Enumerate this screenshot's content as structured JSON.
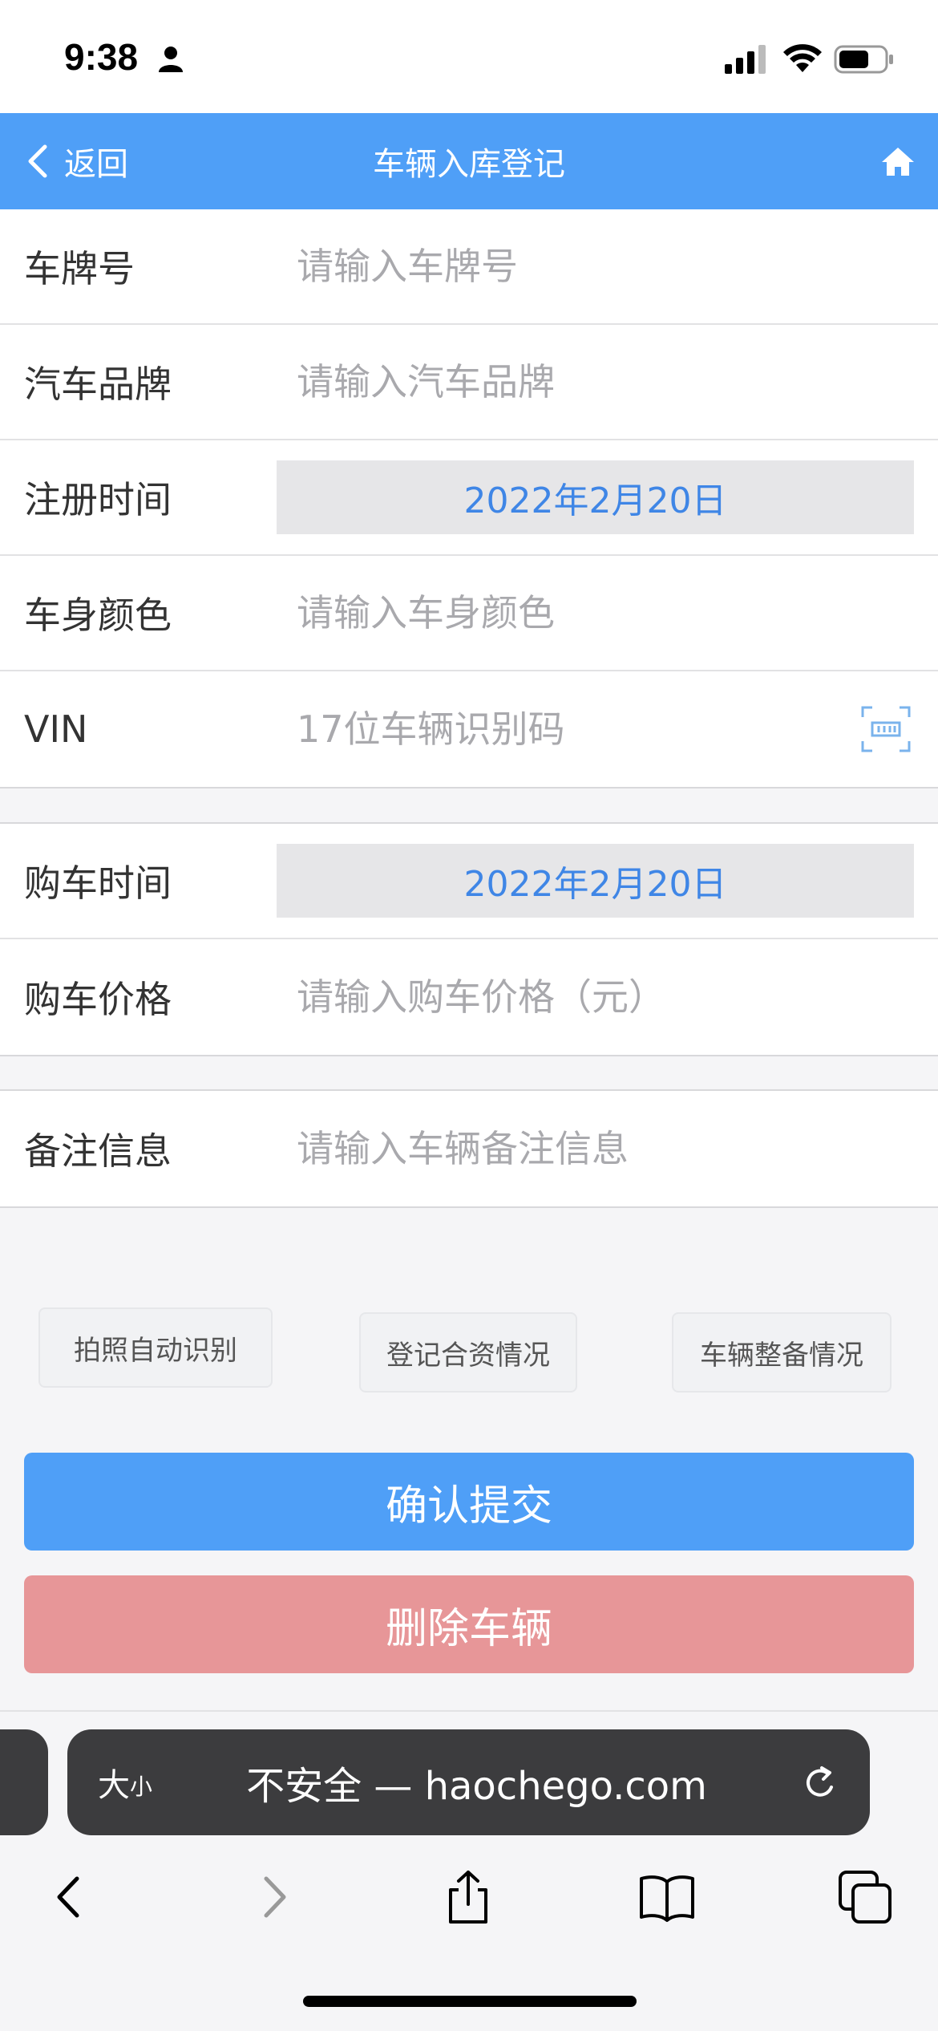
{
  "status_bar": {
    "time": "9:38",
    "icons": [
      "person-icon",
      "signal-icon",
      "wifi-icon",
      "battery-icon"
    ]
  },
  "nav": {
    "back_label": "返回",
    "title": "车辆入库登记",
    "home_icon": "home-icon",
    "color": "#4f9ff7"
  },
  "form": {
    "plate": {
      "label": "车牌号",
      "placeholder": "请输入车牌号"
    },
    "brand": {
      "label": "汽车品牌",
      "placeholder": "请输入汽车品牌"
    },
    "register_time": {
      "label": "注册时间",
      "value": "2022年2月20日"
    },
    "body_color": {
      "label": "车身颜色",
      "placeholder": "请输入车身颜色"
    },
    "vin": {
      "label": "VIN",
      "placeholder": "17位车辆识别码",
      "icon": "scan-icon"
    },
    "purchase_time": {
      "label": "购车时间",
      "value": "2022年2月20日"
    },
    "purchase_price": {
      "label": "购车价格",
      "placeholder": "请输入购车价格（元）"
    },
    "remark": {
      "label": "备注信息",
      "placeholder": "请输入车辆备注信息"
    }
  },
  "options": {
    "photo_recognition": "拍照自动识别",
    "register_funding": "登记合资情况",
    "vehicle_prep": "车辆整备情况"
  },
  "actions": {
    "submit": "确认提交",
    "delete": "删除车辆",
    "submit_color": "#4f9ff7",
    "delete_color": "#e79698"
  },
  "browser": {
    "text_size_big": "大",
    "text_size_small": "小",
    "url": "不安全 — haochego.com",
    "toolbar_icons": [
      "back-icon",
      "forward-icon",
      "share-icon",
      "bookmarks-icon",
      "tabs-icon"
    ]
  }
}
